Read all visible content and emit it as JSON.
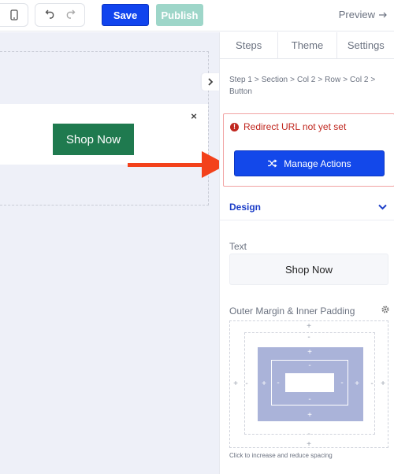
{
  "toolbar": {
    "save_label": "Save",
    "publish_label": "Publish",
    "preview_label": "Preview",
    "device_icon": "mobile-icon",
    "undo_icon": "undo-icon",
    "redo_icon": "redo-icon"
  },
  "canvas": {
    "button_label": "Shop Now",
    "button_color": "#1f7a4f",
    "close_symbol": "×"
  },
  "panel": {
    "tabs": [
      {
        "label": "Steps"
      },
      {
        "label": "Theme"
      },
      {
        "label": "Settings"
      }
    ],
    "breadcrumb": [
      "Step 1",
      "Section",
      "Col 2",
      "Row",
      "Col 2",
      "Button"
    ],
    "alert": {
      "message": "Redirect URL not yet set",
      "color": "#c0271f"
    },
    "manage_actions_label": "Manage Actions",
    "design_section": "Design",
    "text_label": "Text",
    "text_value": "Shop Now",
    "spacing_label": "Outer Margin & Inner Padding",
    "spacing_hint": "Click to increase and reduce spacing",
    "accent_color": "#1348ea",
    "plus": "+",
    "minus": "-"
  },
  "annotation": {
    "arrow_color": "#f3411b"
  }
}
